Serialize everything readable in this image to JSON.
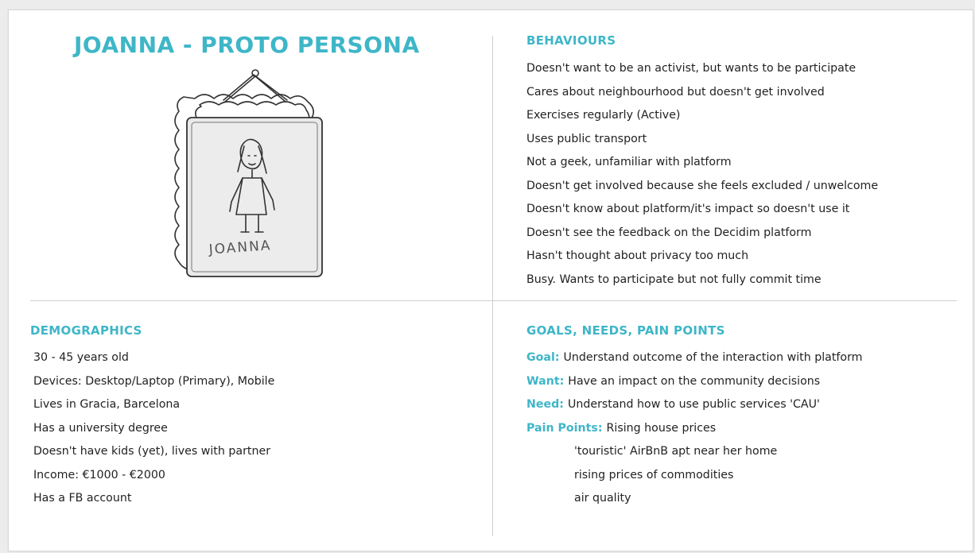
{
  "persona": {
    "title": "JOANNA - PROTO PERSONA",
    "portrait_signature": "JOANNA"
  },
  "behaviours": {
    "heading": "BEHAVIOURS",
    "items": [
      "Doesn't want to be an activist, but wants to be participate",
      "Cares about neighbourhood but doesn't get involved",
      "Exercises regularly (Active)",
      "Uses public transport",
      "Not a geek, unfamiliar with platform",
      "Doesn't get involved because she feels excluded / unwelcome",
      "Doesn't know about platform/it's impact so doesn't use it",
      "Doesn't see the feedback on the Decidim platform",
      "Hasn't thought about privacy too much",
      "Busy. Wants to participate but not fully commit time"
    ]
  },
  "demographics": {
    "heading": "DEMOGRAPHICS",
    "items": [
      "30 - 45 years old",
      "Devices: Desktop/Laptop (Primary), Mobile",
      "Lives in Gracia, Barcelona",
      "Has a university degree",
      "Doesn't have kids (yet), lives with partner",
      "Income: €1000 - €2000",
      "Has a FB account"
    ]
  },
  "goals": {
    "heading": "GOALS, NEEDS, PAIN POINTS",
    "items": [
      {
        "key": "Goal:",
        "text": "Understand outcome of the interaction with platform"
      },
      {
        "key": "Want:",
        "text": "Have an impact on the community decisions"
      },
      {
        "key": "Need:",
        "text": "Understand how to use public services 'CAU'"
      },
      {
        "key": "Pain Points:",
        "text": "Rising house prices"
      }
    ],
    "pain_points_more": [
      "'touristic' AirBnB apt near her home",
      "rising prices of commodities",
      "air quality"
    ]
  },
  "colors": {
    "accent": "#3eb6c8",
    "text": "#222222",
    "divider": "#cfcfcf",
    "spellcheck_underline": "#d9534f"
  }
}
